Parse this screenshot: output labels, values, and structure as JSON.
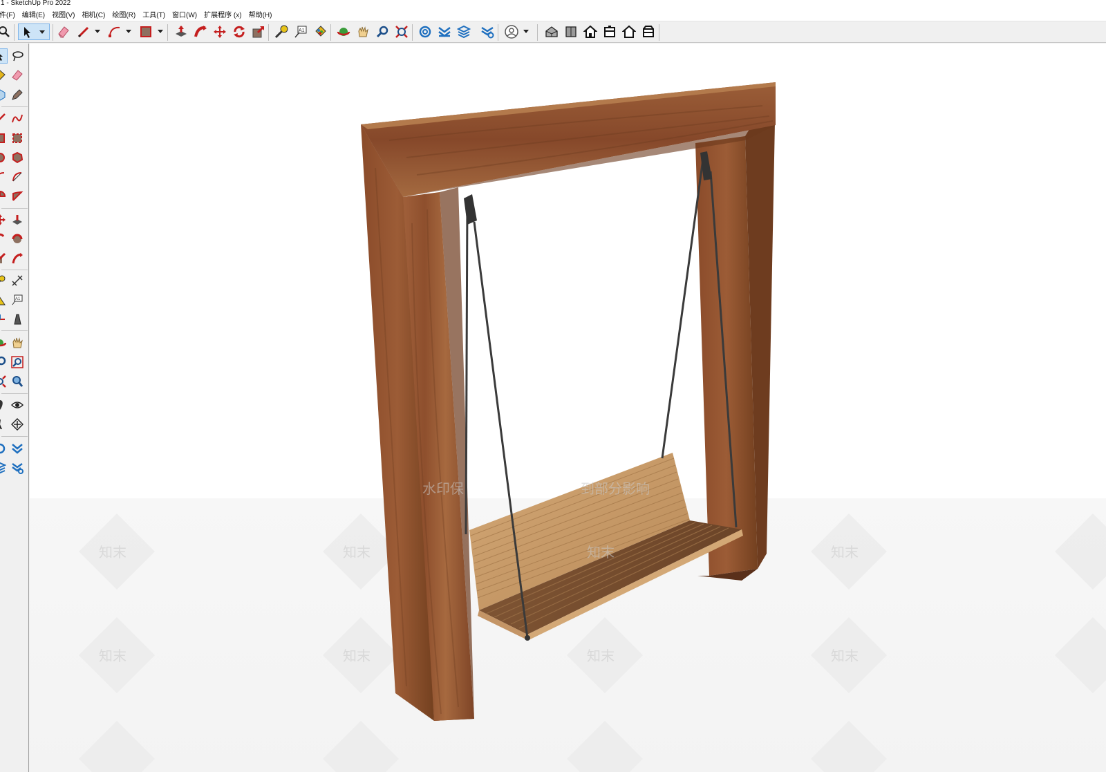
{
  "window": {
    "title": "1 - SketchUp Pro 2022"
  },
  "menu": {
    "items": [
      {
        "label": "件(F)"
      },
      {
        "label": "编辑(E)"
      },
      {
        "label": "视图(V)"
      },
      {
        "label": "相机(C)"
      },
      {
        "label": "绘图(R)"
      },
      {
        "label": "工具(T)"
      },
      {
        "label": "窗口(W)"
      },
      {
        "label": "扩展程序 (x)"
      },
      {
        "label": "帮助(H)"
      }
    ]
  },
  "toolbar": {
    "icons": [
      "zoom-icon",
      "select-icon",
      "eraser-icon",
      "pencil-icon",
      "arc-icon",
      "rectangle-icon",
      "push-pull-icon",
      "follow-me-icon",
      "move-icon",
      "rotate-icon",
      "scale-icon",
      "tape-measure-icon",
      "text-icon",
      "paint-bucket-icon",
      "orbit-icon",
      "pan-icon",
      "zoom-window-icon",
      "zoom-extents-icon",
      "warehouse-icon",
      "extension-warehouse-icon",
      "layout-icon",
      "extension-manager-icon",
      "account-icon",
      "iso-view-icon",
      "top-view-icon",
      "front-view-icon",
      "right-view-icon",
      "back-view-icon",
      "left-view-icon"
    ],
    "active_tool": "select-icon"
  },
  "viewport": {
    "watermarks": [
      {
        "text": "水印保"
      },
      {
        "text": "到部分影响"
      },
      {
        "text": "知末"
      }
    ],
    "colors": {
      "wood_dark": "#7a4426",
      "wood_mid": "#9c5a34",
      "wood_light": "#b87a4e",
      "seat_light": "#c99c6c",
      "rope": "#3a3a3a",
      "background": "#ffffff",
      "ground": "#f5f5f5"
    }
  }
}
